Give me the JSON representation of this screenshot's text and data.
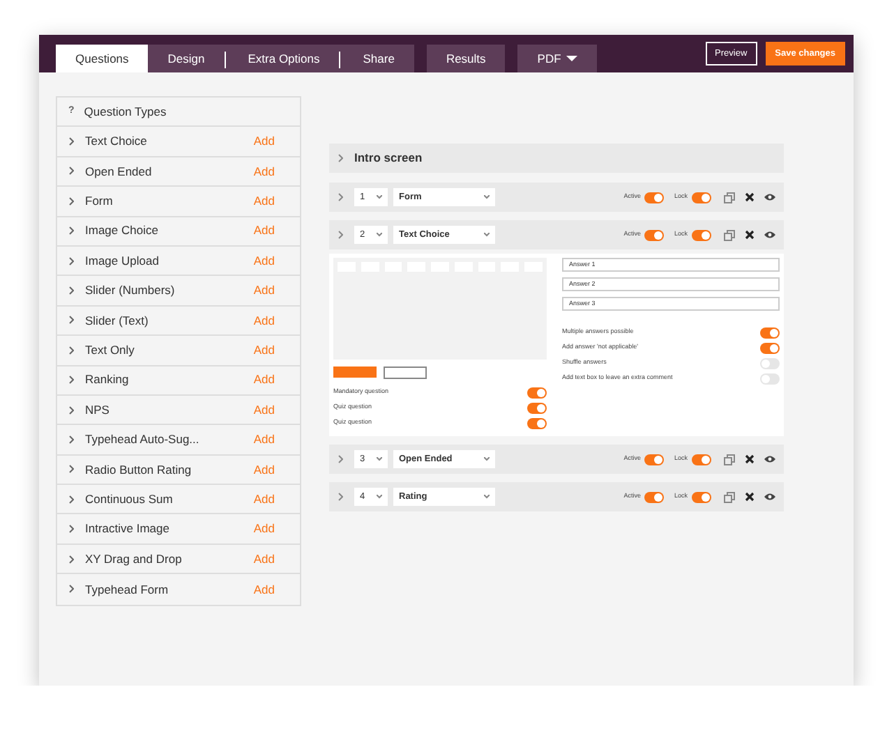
{
  "tabs": [
    {
      "label": "Questions",
      "selected": true,
      "joined": false,
      "kind": "tab"
    },
    {
      "label": "Design",
      "selected": false,
      "joined": false,
      "kind": "tab"
    },
    {
      "label": "Extra Options",
      "selected": false,
      "joined": true,
      "kind": "tab"
    },
    {
      "label": "Share",
      "selected": false,
      "joined": true,
      "kind": "tab"
    },
    {
      "label": "Results",
      "selected": false,
      "joined": false,
      "kind": "tab"
    },
    {
      "label": "PDF",
      "selected": false,
      "joined": false,
      "kind": "dropdown"
    }
  ],
  "header_buttons": [
    {
      "label": "Preview",
      "kind": "outline"
    },
    {
      "label": "Save changes",
      "kind": "primary"
    }
  ],
  "sidebar": {
    "icon": "?",
    "title": "Question Types",
    "items": [
      {
        "label": "Text Choice",
        "action": "Add"
      },
      {
        "label": "Open Ended",
        "action": "Add"
      },
      {
        "label": "Form",
        "action": "Add"
      },
      {
        "label": "Image Choice",
        "action": "Add"
      },
      {
        "label": "Image Upload",
        "action": "Add"
      },
      {
        "label": "Slider (Numbers)",
        "action": "Add"
      },
      {
        "label": "Slider (Text)",
        "action": "Add"
      },
      {
        "label": "Text Only",
        "action": "Add"
      },
      {
        "label": "Ranking",
        "action": "Add"
      },
      {
        "label": "NPS",
        "action": "Add"
      },
      {
        "label": "Typehead Auto-Sug...",
        "action": "Add"
      },
      {
        "label": "Radio Button Rating",
        "action": "Add"
      },
      {
        "label": "Continuous Sum",
        "action": "Add"
      },
      {
        "label": "Intractive Image",
        "action": "Add"
      },
      {
        "label": "XY Drag and Drop",
        "action": "Add"
      },
      {
        "label": "Typehead Form",
        "action": "Add"
      }
    ]
  },
  "intro": {
    "title": "Intro screen"
  },
  "questions": [
    {
      "number": "1",
      "type": "Form",
      "active_label": "Active",
      "active": true,
      "lock_label": "Lock",
      "lock": true
    },
    {
      "number": "2",
      "type": "Text Choice",
      "active_label": "Active",
      "active": true,
      "lock_label": "Lock",
      "lock": true,
      "details": {
        "left_toggles": [
          {
            "label": "Mandatory question",
            "on": true
          },
          {
            "label": "Quiz question",
            "on": true
          },
          {
            "label": "Quiz question",
            "on": true
          }
        ],
        "answers": [
          {
            "value": "Answer 1"
          },
          {
            "value": "Answer 2"
          },
          {
            "value": "Answer 3"
          }
        ],
        "right_toggles": [
          {
            "label": "Multiple answers possible",
            "on": true
          },
          {
            "label": "Add answer 'not applicable'",
            "on": true
          },
          {
            "label": "Shuffle answers",
            "on": false
          },
          {
            "label": "Add text box to leave an extra comment",
            "on": false
          }
        ]
      }
    },
    {
      "number": "3",
      "type": "Open Ended",
      "active_label": "Active",
      "active": true,
      "lock_label": "Lock",
      "lock": true
    },
    {
      "number": "4",
      "type": "Rating",
      "active_label": "Active",
      "active": true,
      "lock_label": "Lock",
      "lock": true
    }
  ]
}
